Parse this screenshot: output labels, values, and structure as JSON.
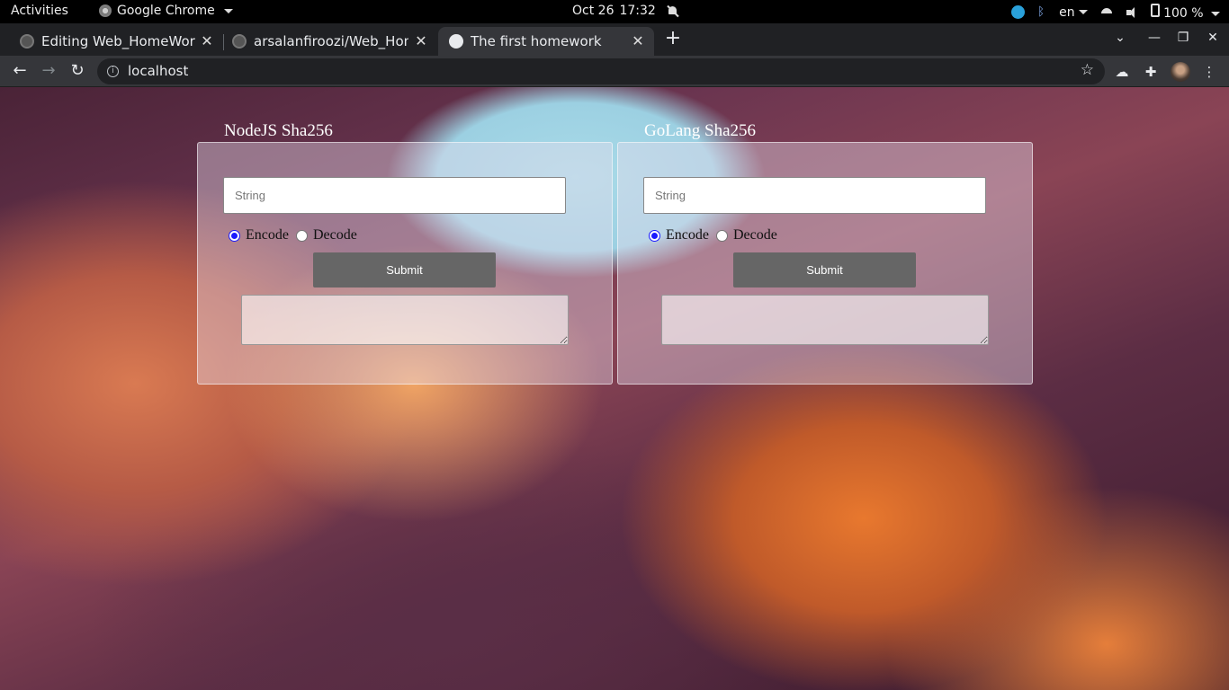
{
  "system_bar": {
    "activities": "Activities",
    "app_name": "Google Chrome",
    "date": "Oct 26",
    "time": "17:32",
    "language": "en",
    "battery": "100 %"
  },
  "tabs": [
    {
      "title": "Editing Web_HomeWork",
      "active": false
    },
    {
      "title": "arsalanfiroozi/Web_Hom",
      "active": false
    },
    {
      "title": "The first homework",
      "active": true
    }
  ],
  "address_bar": {
    "url": "localhost"
  },
  "panels": [
    {
      "title": "NodeJS Sha256",
      "input_placeholder": "String",
      "radio_encode": "Encode",
      "radio_decode": "Decode",
      "selected": "Encode",
      "submit_label": "Submit"
    },
    {
      "title": "GoLang Sha256",
      "input_placeholder": "String",
      "radio_encode": "Encode",
      "radio_decode": "Decode",
      "selected": "Encode",
      "submit_label": "Submit"
    }
  ]
}
